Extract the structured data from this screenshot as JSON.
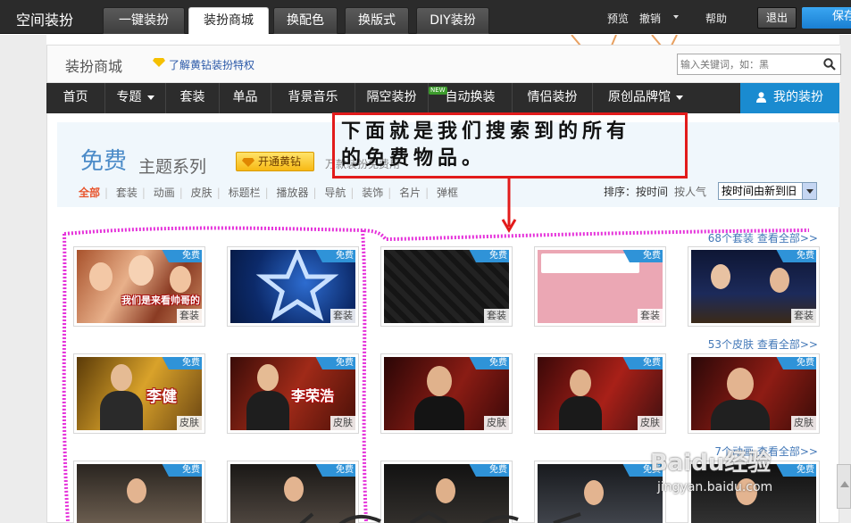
{
  "topbar": {
    "app_title": "空间装扮",
    "tabs": [
      "一键装扮",
      "装扮商城",
      "换配色",
      "换版式",
      "DIY装扮"
    ],
    "preview": "预览",
    "undo": "撤销",
    "help": "帮助",
    "exit": "退出",
    "save": "保存"
  },
  "header": {
    "store_title": "装扮商城",
    "vip_link": "了解黄钻装扮特权",
    "search_placeholder": "输入关键词，如：黑"
  },
  "nav": {
    "items": [
      "首页",
      "专题",
      "套装",
      "单品",
      "背景音乐",
      "隔空装扮",
      "自动换装",
      "情侣装扮",
      "原创品牌馆"
    ],
    "new_badge": "NEW",
    "my_dress": "我的装扮"
  },
  "banner": {
    "free": "免费",
    "series": "主题系列",
    "open_vip": "开通黄钻",
    "sub_text": "万款装扮免费用"
  },
  "categories": [
    "全部",
    "套装",
    "动画",
    "皮肤",
    "标题栏",
    "播放器",
    "导航",
    "装饰",
    "名片",
    "弹框"
  ],
  "sort": {
    "label": "排序：",
    "by_time": "按时间",
    "by_popularity": "按人气",
    "selected": "按时间由新到旧"
  },
  "rows": [
    {
      "count_text": "68个套装",
      "view_all": "查看全部>>",
      "type": "套装"
    },
    {
      "count_text": "53个皮肤",
      "view_all": "查看全部>>",
      "type": "皮肤"
    },
    {
      "count_text": "7个动画",
      "view_all": "查看全部>>",
      "type": "动画"
    }
  ],
  "free_tag": "免费",
  "thumb_texts": {
    "r0c0": "我们是来看帅哥的",
    "r1c0": "李健",
    "r1c1": "李荣浩"
  },
  "annotation": {
    "line1": "下面就是我们搜索到的所有",
    "line2": "的免费物品。",
    "color": "#e21b1b"
  },
  "watermark": {
    "logo": "Baidu经验",
    "url": "jingyan.baidu.com"
  },
  "colors": {
    "accent_blue": "#1a8bd0",
    "free_flag": "#2f93d8",
    "nav_bg": "#2c2c2c",
    "topbar_bg": "#2b2b2b",
    "active_category": "#e8542c",
    "highlight": "#e21bd6"
  }
}
